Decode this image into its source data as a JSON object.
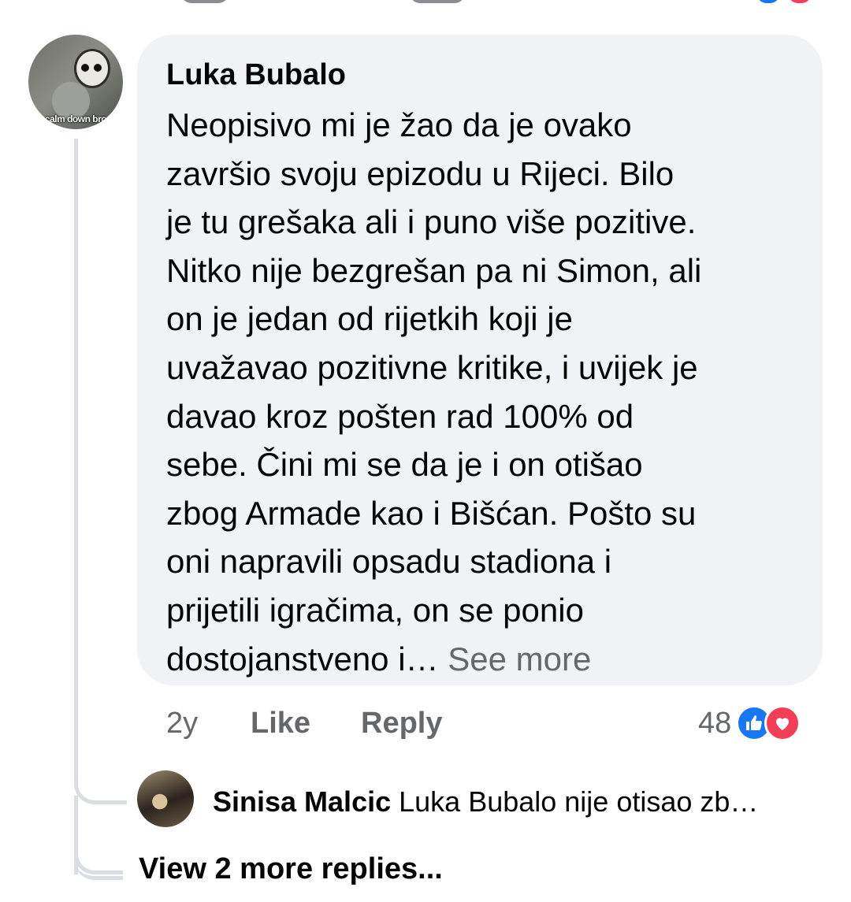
{
  "comment": {
    "author": "Luka Bubalo",
    "avatar_caption": "calm down bro",
    "text_lines": [
      "Neopisivo mi je žao da je ovako",
      "završio svoju epizodu u Rijeci.  Bilo",
      "je tu grešaka ali i puno više pozitive.",
      "Nitko nije bezgrešan pa ni Simon, ali",
      "on je jedan od rijetkih koji je",
      "uvažavao pozitivne kritike, i uvijek je",
      "davao kroz pošten rad 100% od",
      "sebe. Čini mi se da je i on otišao",
      "zbog Armade kao i Bišćan. Pošto su",
      "oni napravili opsadu stadiona i",
      "prijetili igračima, on se ponio",
      "dostojanstveno i…"
    ],
    "see_more": "See more",
    "time": "2y",
    "like_label": "Like",
    "reply_label": "Reply",
    "reaction_count": "48",
    "reaction_icons": [
      "like-icon",
      "love-icon"
    ],
    "colors": {
      "bubble": "#f0f2f5",
      "meta": "#65676b",
      "like": "#1877f2",
      "love": "#f33e58"
    }
  },
  "reply": {
    "author": "Sinisa Malcic",
    "snippet": "Luka Bubalo nije otisao zb…"
  },
  "view_more": "View 2 more replies..."
}
